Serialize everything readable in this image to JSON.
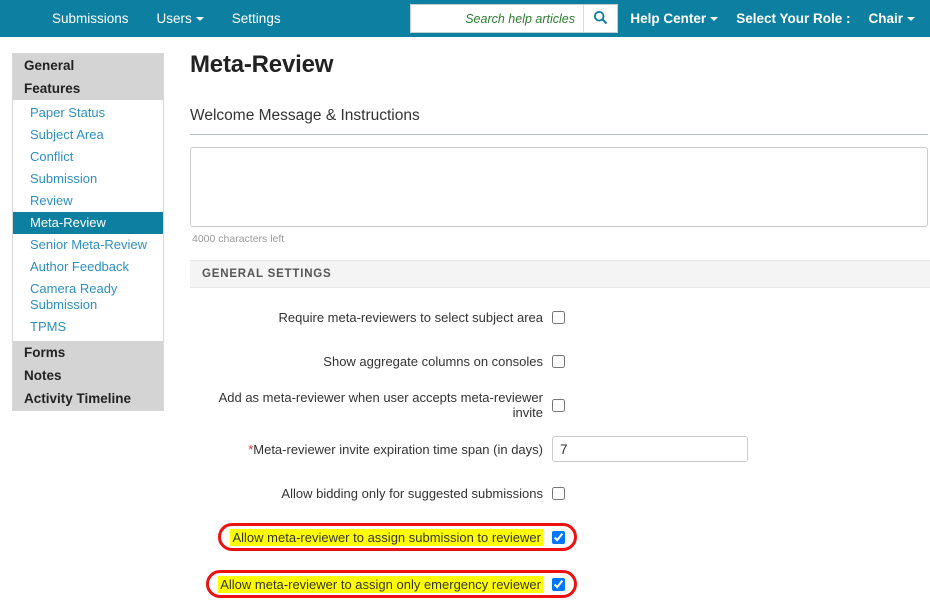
{
  "navbar": {
    "left_items": [
      {
        "label": "Submissions",
        "caret": false,
        "name": "nav-submissions"
      },
      {
        "label": "Users",
        "caret": true,
        "name": "nav-users"
      },
      {
        "label": "Settings",
        "caret": false,
        "name": "nav-settings"
      }
    ],
    "search": {
      "placeholder": "Search help articles",
      "value": "",
      "icon": "search-icon"
    },
    "right_items": [
      {
        "label": "Help Center",
        "caret": true,
        "name": "nav-help-center"
      },
      {
        "label": "Select Your Role :",
        "caret": false,
        "name": "nav-select-your-role"
      },
      {
        "label": "Chair",
        "caret": true,
        "name": "nav-role-chair"
      }
    ],
    "background_color": "#0d7fa1"
  },
  "sidebar": {
    "headers": {
      "general": "General",
      "features": "Features"
    },
    "feature_items": [
      {
        "label": "Paper Status",
        "active": false
      },
      {
        "label": "Subject Area",
        "active": false
      },
      {
        "label": "Conflict",
        "active": false
      },
      {
        "label": "Submission",
        "active": false
      },
      {
        "label": "Review",
        "active": false
      },
      {
        "label": "Meta-Review",
        "active": true
      },
      {
        "label": "Senior Meta-Review",
        "active": false
      },
      {
        "label": "Author Feedback",
        "active": false
      },
      {
        "label": "Camera Ready Submission",
        "active": false
      },
      {
        "label": "TPMS",
        "active": false
      }
    ],
    "footer_items": [
      {
        "label": "Forms"
      },
      {
        "label": "Notes"
      },
      {
        "label": "Activity Timeline"
      }
    ],
    "active_color": "#0d7fa1",
    "link_color": "#2e8fc0"
  },
  "main": {
    "page_title": "Meta-Review",
    "welcome_section_label": "Welcome Message & Instructions",
    "welcome_textarea_value": "",
    "welcome_textarea_placeholder": "",
    "characters_left": "4000 characters left",
    "general_settings_header": "GENERAL SETTINGS",
    "settings": [
      {
        "label": "Require meta-reviewers to select subject area",
        "type": "checkbox",
        "checked": false,
        "highlighted": false,
        "required": false,
        "name": "setting-require-subject-area"
      },
      {
        "label": "Show aggregate columns on consoles",
        "type": "checkbox",
        "checked": false,
        "highlighted": false,
        "required": false,
        "name": "setting-show-aggregate-columns"
      },
      {
        "label": "Add as meta-reviewer when user accepts meta-reviewer invite",
        "type": "checkbox",
        "checked": false,
        "highlighted": false,
        "required": false,
        "name": "setting-add-as-meta-reviewer-on-accept"
      },
      {
        "label": "Meta-reviewer invite expiration time span (in days)",
        "type": "text",
        "value": "7",
        "highlighted": false,
        "required": true,
        "name": "setting-invite-expiration-days"
      },
      {
        "label": "Allow bidding only for suggested submissions",
        "type": "checkbox",
        "checked": false,
        "highlighted": false,
        "required": false,
        "name": "setting-allow-bidding-suggested-only"
      },
      {
        "label": "Allow meta-reviewer to assign submission to reviewer",
        "type": "checkbox",
        "checked": true,
        "highlighted": true,
        "required": false,
        "name": "setting-allow-assign-submission-to-reviewer"
      },
      {
        "label": "Allow meta-reviewer to assign only emergency reviewer",
        "type": "checkbox",
        "checked": true,
        "highlighted": true,
        "required": false,
        "name": "setting-allow-assign-only-emergency-reviewer"
      }
    ],
    "highlight_colors": {
      "annotation_border": "#ee1111",
      "text_highlight": "#ffff00"
    }
  }
}
